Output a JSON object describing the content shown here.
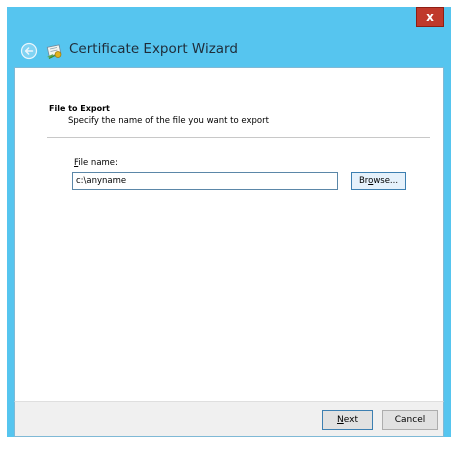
{
  "window": {
    "title": "Certificate Export Wizard",
    "close_glyph": "x",
    "accent": "#56c5ef"
  },
  "icons": {
    "back": "back-arrow-icon",
    "title_icon": "certificate-icon",
    "close": "close-icon"
  },
  "section": {
    "title": "File to Export",
    "description": "Specify the name of the file you want to export"
  },
  "file": {
    "label_accel": "F",
    "label_rest": "ile name:",
    "value": "c:\\anyname",
    "browse_before": "Br",
    "browse_accel": "o",
    "browse_after": "wse..."
  },
  "footer": {
    "next_accel": "N",
    "next_rest": "ext",
    "cancel_label": "Cancel"
  }
}
